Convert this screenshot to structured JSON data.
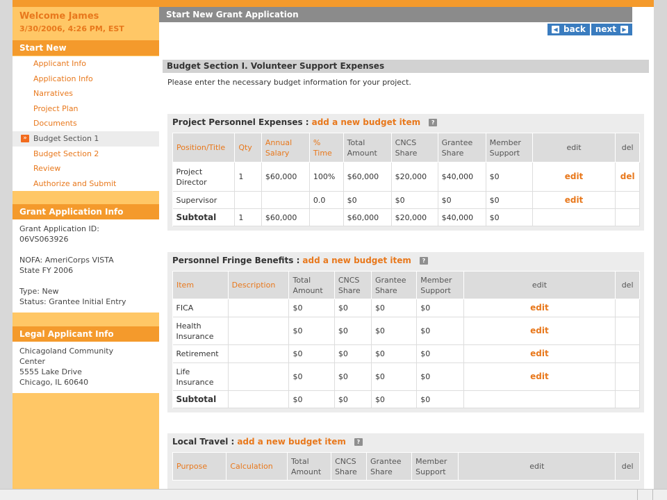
{
  "sidebar": {
    "welcome": "Welcome James",
    "datetime": "3/30/2006, 4:26 PM, EST",
    "start_new": "Start New",
    "nav": [
      {
        "label": "Applicant Info",
        "active": false
      },
      {
        "label": "Application Info",
        "active": false
      },
      {
        "label": "Narratives",
        "active": false
      },
      {
        "label": "Project Plan",
        "active": false
      },
      {
        "label": "Documents",
        "active": false
      },
      {
        "label": "Budget Section 1",
        "active": true
      },
      {
        "label": "Budget Section 2",
        "active": false
      },
      {
        "label": "Review",
        "active": false
      },
      {
        "label": "Authorize and Submit",
        "active": false
      }
    ],
    "grant_info": {
      "title": "Grant Application Info",
      "id_label": "Grant Application ID:",
      "id_value": "06VS063926",
      "nofa_line1": "NOFA: AmeriCorps VISTA",
      "nofa_line2": "State FY 2006",
      "type": "Type: New",
      "status": "Status: Grantee Initial Entry"
    },
    "legal_info": {
      "title": "Legal Applicant Info",
      "line1": "Chicagoland Community",
      "line2": "Center",
      "line3": "5555 Lake Drive",
      "line4": "Chicago, IL 60640"
    }
  },
  "main": {
    "title": "Start New Grant Application",
    "back_label": "back",
    "next_label": "next",
    "section_title": "Budget Section I. Volunteer Support Expenses",
    "intro": "Please enter the necessary budget information for your project.",
    "add_label": "add a new budget item",
    "help_glyph": "?",
    "edit_label": "edit",
    "del_label": "del",
    "personnel": {
      "title": "Project Personnel Expenses :",
      "headers": [
        "Position/Title",
        "Qty",
        "Annual Salary",
        "% Time",
        "Total Amount",
        "CNCS Share",
        "Grantee Share",
        "Member Support",
        "edit",
        "del"
      ],
      "rows": [
        {
          "cells": [
            "Project Director",
            "1",
            "$60,000",
            "100%",
            "$60,000",
            "$20,000",
            "$40,000",
            "$0"
          ],
          "edit": true,
          "del": true
        },
        {
          "cells": [
            "Supervisor",
            "",
            "",
            "0.0",
            "$0",
            "$0",
            "$0",
            "$0"
          ],
          "edit": true,
          "del": false
        }
      ],
      "subtotal": [
        "Subtotal",
        "1",
        "$60,000",
        "",
        "$60,000",
        "$20,000",
        "$40,000",
        "$0"
      ]
    },
    "fringe": {
      "title": "Personnel Fringe Benefits :",
      "headers": [
        "Item",
        "Description",
        "Total Amount",
        "CNCS Share",
        "Grantee Share",
        "Member Support",
        "edit",
        "del"
      ],
      "rows": [
        {
          "cells": [
            "FICA",
            "",
            "$0",
            "$0",
            "$0",
            "$0"
          ],
          "edit": true
        },
        {
          "cells": [
            "Health Insurance",
            "",
            "$0",
            "$0",
            "$0",
            "$0"
          ],
          "edit": true
        },
        {
          "cells": [
            "Retirement",
            "",
            "$0",
            "$0",
            "$0",
            "$0"
          ],
          "edit": true
        },
        {
          "cells": [
            "Life Insurance",
            "",
            "$0",
            "$0",
            "$0",
            "$0"
          ],
          "edit": true
        }
      ],
      "subtotal": [
        "Subtotal",
        "",
        "$0",
        "$0",
        "$0",
        "$0"
      ]
    },
    "travel": {
      "title": "Local Travel :",
      "headers": [
        "Purpose",
        "Calculation",
        "Total Amount",
        "CNCS Share",
        "Grantee Share",
        "Member Support",
        "edit",
        "del"
      ]
    }
  }
}
